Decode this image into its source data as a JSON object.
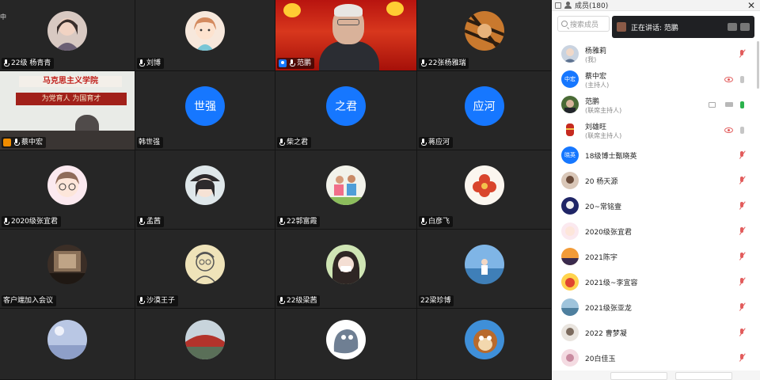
{
  "grid": {
    "tiles": [
      {
        "label": "22级 杨青青",
        "avatar": "girl-photo",
        "corner": "中"
      },
      {
        "label": "刘博",
        "avatar": "cartoon-girl"
      },
      {
        "label": "范鹏",
        "avatar": "video",
        "host": true
      },
      {
        "label": "22张杨雅瑞",
        "avatar": "tiger-photo"
      },
      {
        "label": "蔡中宏",
        "avatar": "video-hall"
      },
      {
        "label": "韩世强",
        "avatar_text": "世强"
      },
      {
        "label": "柴之君",
        "avatar_text": "之君"
      },
      {
        "label": "蒋应河",
        "avatar_text": "应河"
      },
      {
        "label": "2020级张宜君",
        "avatar": "cartoon-glasses"
      },
      {
        "label": "孟茜",
        "avatar": "cartoon-hat"
      },
      {
        "label": "22郭富霞",
        "avatar": "group-photo"
      },
      {
        "label": "白彦飞",
        "avatar": "flower"
      },
      {
        "label": "客户端加入会议",
        "avatar": "room-photo"
      },
      {
        "label": "沙漠王子",
        "avatar": "sketch"
      },
      {
        "label": "22级梁茜",
        "avatar": "girl-mask"
      },
      {
        "label": "22梁珍博",
        "avatar": "beach"
      },
      {
        "label": "",
        "avatar": "sky"
      },
      {
        "label": "",
        "avatar": "bridge"
      },
      {
        "label": "",
        "avatar": "cartoon-bird"
      },
      {
        "label": "",
        "avatar": "squirrel"
      }
    ],
    "hall": {
      "banner": "马克思主义学院",
      "slogan": "为党育人 为国育才"
    }
  },
  "panel": {
    "title": "成员(180)",
    "search_placeholder": "搜索成员",
    "speaking_label": "正在讲话: 范鹏",
    "members": [
      {
        "name": "杨雅莉",
        "role": "(我)",
        "avatar": "photo-1",
        "state": "muted"
      },
      {
        "name": "蔡中宏",
        "role": "(主持人)",
        "avatar_text": "中宏",
        "state": "host"
      },
      {
        "name": "范鹏",
        "role": "(联席主持人)",
        "avatar": "photo-2",
        "state": "speaking"
      },
      {
        "name": "刘雄旺",
        "role": "(联席主持人)",
        "avatar": "photo-3",
        "state": "host"
      },
      {
        "name": "18级博士甄晓英",
        "role": "",
        "avatar_text": "晓英",
        "state": "muted"
      },
      {
        "name": "20 杨天源",
        "role": "",
        "avatar": "photo-4",
        "state": "muted"
      },
      {
        "name": "20~常铭壹",
        "role": "",
        "avatar": "photo-5",
        "state": "muted"
      },
      {
        "name": "2020级张宜君",
        "role": "",
        "avatar": "photo-6",
        "state": "muted"
      },
      {
        "name": "2021陈宇",
        "role": "",
        "avatar": "photo-7",
        "state": "muted"
      },
      {
        "name": "2021级~李宜容",
        "role": "",
        "avatar": "photo-8",
        "state": "muted"
      },
      {
        "name": "2021级张亚龙",
        "role": "",
        "avatar": "photo-9",
        "state": "muted"
      },
      {
        "name": "2022 曹梦凝",
        "role": "",
        "avatar": "photo-10",
        "state": "muted"
      },
      {
        "name": "20白佳玉",
        "role": "",
        "avatar": "photo-11",
        "state": "muted"
      }
    ]
  },
  "colors": {
    "accent": "#1677ff",
    "muted": "#e25c5c",
    "active_mic": "#2bb24c"
  }
}
